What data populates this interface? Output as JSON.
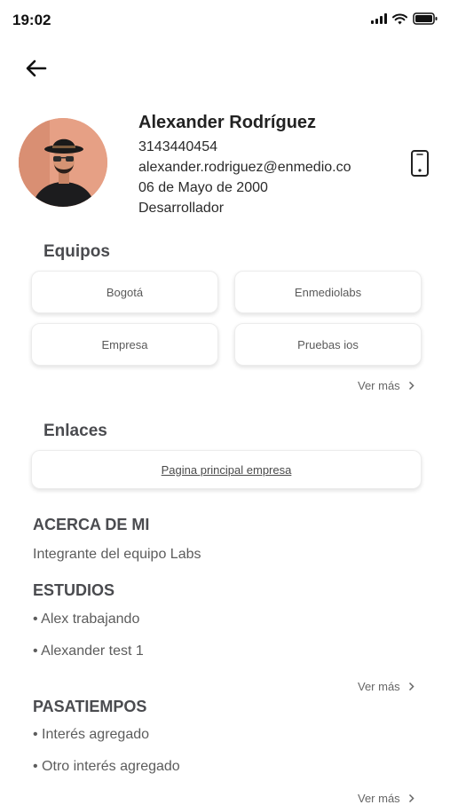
{
  "status": {
    "time": "19:02"
  },
  "profile": {
    "name": "Alexander Rodríguez",
    "phone": "3143440454",
    "email": "alexander.rodriguez@enmedio.co",
    "birthdate": "06 de Mayo de 2000",
    "role": "Desarrollador"
  },
  "equipos": {
    "title": "Equipos",
    "items": [
      "Bogotá",
      "Enmediolabs",
      "Empresa",
      "Pruebas ios"
    ],
    "ver_mas": "Ver más"
  },
  "enlaces": {
    "title": "Enlaces",
    "link": "Pagina principal empresa"
  },
  "acerca": {
    "title": "ACERCA DE MI",
    "text": "Integrante del equipo Labs"
  },
  "estudios": {
    "title": "ESTUDIOS",
    "items": [
      "• Alex trabajando",
      "• Alexander test 1"
    ],
    "ver_mas": "Ver más"
  },
  "pasatiempos": {
    "title": "PASATIEMPOS",
    "items": [
      "• Interés agregado",
      "• Otro interés agregado"
    ],
    "ver_mas": "Ver más"
  },
  "icons": {
    "back": "arrow-left-icon",
    "device": "smartphone-icon",
    "chevron": "chevron-right-icon"
  }
}
